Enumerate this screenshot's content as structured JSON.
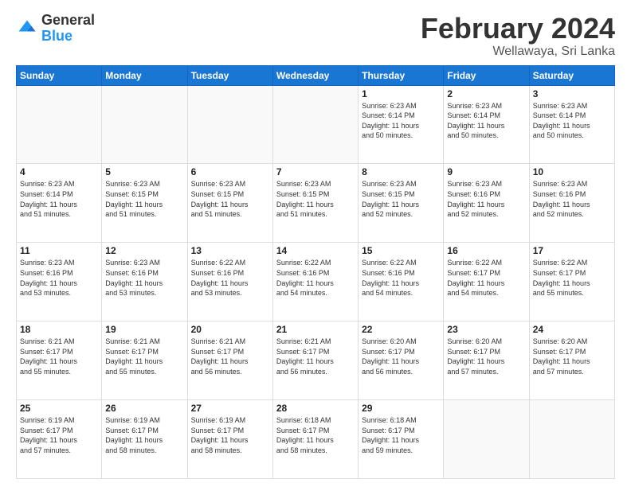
{
  "header": {
    "logo_general": "General",
    "logo_blue": "Blue",
    "month_title": "February 2024",
    "subtitle": "Wellawaya, Sri Lanka"
  },
  "weekdays": [
    "Sunday",
    "Monday",
    "Tuesday",
    "Wednesday",
    "Thursday",
    "Friday",
    "Saturday"
  ],
  "weeks": [
    [
      {
        "day": "",
        "info": ""
      },
      {
        "day": "",
        "info": ""
      },
      {
        "day": "",
        "info": ""
      },
      {
        "day": "",
        "info": ""
      },
      {
        "day": "1",
        "info": "Sunrise: 6:23 AM\nSunset: 6:14 PM\nDaylight: 11 hours\nand 50 minutes."
      },
      {
        "day": "2",
        "info": "Sunrise: 6:23 AM\nSunset: 6:14 PM\nDaylight: 11 hours\nand 50 minutes."
      },
      {
        "day": "3",
        "info": "Sunrise: 6:23 AM\nSunset: 6:14 PM\nDaylight: 11 hours\nand 50 minutes."
      }
    ],
    [
      {
        "day": "4",
        "info": "Sunrise: 6:23 AM\nSunset: 6:14 PM\nDaylight: 11 hours\nand 51 minutes."
      },
      {
        "day": "5",
        "info": "Sunrise: 6:23 AM\nSunset: 6:15 PM\nDaylight: 11 hours\nand 51 minutes."
      },
      {
        "day": "6",
        "info": "Sunrise: 6:23 AM\nSunset: 6:15 PM\nDaylight: 11 hours\nand 51 minutes."
      },
      {
        "day": "7",
        "info": "Sunrise: 6:23 AM\nSunset: 6:15 PM\nDaylight: 11 hours\nand 51 minutes."
      },
      {
        "day": "8",
        "info": "Sunrise: 6:23 AM\nSunset: 6:15 PM\nDaylight: 11 hours\nand 52 minutes."
      },
      {
        "day": "9",
        "info": "Sunrise: 6:23 AM\nSunset: 6:16 PM\nDaylight: 11 hours\nand 52 minutes."
      },
      {
        "day": "10",
        "info": "Sunrise: 6:23 AM\nSunset: 6:16 PM\nDaylight: 11 hours\nand 52 minutes."
      }
    ],
    [
      {
        "day": "11",
        "info": "Sunrise: 6:23 AM\nSunset: 6:16 PM\nDaylight: 11 hours\nand 53 minutes."
      },
      {
        "day": "12",
        "info": "Sunrise: 6:23 AM\nSunset: 6:16 PM\nDaylight: 11 hours\nand 53 minutes."
      },
      {
        "day": "13",
        "info": "Sunrise: 6:22 AM\nSunset: 6:16 PM\nDaylight: 11 hours\nand 53 minutes."
      },
      {
        "day": "14",
        "info": "Sunrise: 6:22 AM\nSunset: 6:16 PM\nDaylight: 11 hours\nand 54 minutes."
      },
      {
        "day": "15",
        "info": "Sunrise: 6:22 AM\nSunset: 6:16 PM\nDaylight: 11 hours\nand 54 minutes."
      },
      {
        "day": "16",
        "info": "Sunrise: 6:22 AM\nSunset: 6:17 PM\nDaylight: 11 hours\nand 54 minutes."
      },
      {
        "day": "17",
        "info": "Sunrise: 6:22 AM\nSunset: 6:17 PM\nDaylight: 11 hours\nand 55 minutes."
      }
    ],
    [
      {
        "day": "18",
        "info": "Sunrise: 6:21 AM\nSunset: 6:17 PM\nDaylight: 11 hours\nand 55 minutes."
      },
      {
        "day": "19",
        "info": "Sunrise: 6:21 AM\nSunset: 6:17 PM\nDaylight: 11 hours\nand 55 minutes."
      },
      {
        "day": "20",
        "info": "Sunrise: 6:21 AM\nSunset: 6:17 PM\nDaylight: 11 hours\nand 56 minutes."
      },
      {
        "day": "21",
        "info": "Sunrise: 6:21 AM\nSunset: 6:17 PM\nDaylight: 11 hours\nand 56 minutes."
      },
      {
        "day": "22",
        "info": "Sunrise: 6:20 AM\nSunset: 6:17 PM\nDaylight: 11 hours\nand 56 minutes."
      },
      {
        "day": "23",
        "info": "Sunrise: 6:20 AM\nSunset: 6:17 PM\nDaylight: 11 hours\nand 57 minutes."
      },
      {
        "day": "24",
        "info": "Sunrise: 6:20 AM\nSunset: 6:17 PM\nDaylight: 11 hours\nand 57 minutes."
      }
    ],
    [
      {
        "day": "25",
        "info": "Sunrise: 6:19 AM\nSunset: 6:17 PM\nDaylight: 11 hours\nand 57 minutes."
      },
      {
        "day": "26",
        "info": "Sunrise: 6:19 AM\nSunset: 6:17 PM\nDaylight: 11 hours\nand 58 minutes."
      },
      {
        "day": "27",
        "info": "Sunrise: 6:19 AM\nSunset: 6:17 PM\nDaylight: 11 hours\nand 58 minutes."
      },
      {
        "day": "28",
        "info": "Sunrise: 6:18 AM\nSunset: 6:17 PM\nDaylight: 11 hours\nand 58 minutes."
      },
      {
        "day": "29",
        "info": "Sunrise: 6:18 AM\nSunset: 6:17 PM\nDaylight: 11 hours\nand 59 minutes."
      },
      {
        "day": "",
        "info": ""
      },
      {
        "day": "",
        "info": ""
      }
    ]
  ]
}
